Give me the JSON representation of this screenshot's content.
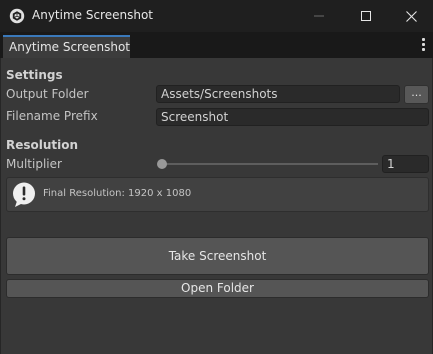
{
  "window": {
    "title": "Anytime Screenshot",
    "icon": "unity-icon"
  },
  "tab": {
    "label": "Anytime Screenshot"
  },
  "settings": {
    "header": "Settings",
    "output_folder_label": "Output Folder",
    "output_folder_value": "Assets/Screenshots",
    "browse_label": "...",
    "filename_prefix_label": "Filename Prefix",
    "filename_prefix_value": "Screenshot"
  },
  "resolution": {
    "header": "Resolution",
    "multiplier_label": "Multiplier",
    "multiplier_value": "1",
    "slider_fraction": 0.0,
    "info_message": "Final Resolution: 1920 x 1080"
  },
  "actions": {
    "take_screenshot_label": "Take Screenshot",
    "open_folder_label": "Open Folder"
  },
  "colors": {
    "accent": "#3a79bb",
    "background": "#383838"
  }
}
